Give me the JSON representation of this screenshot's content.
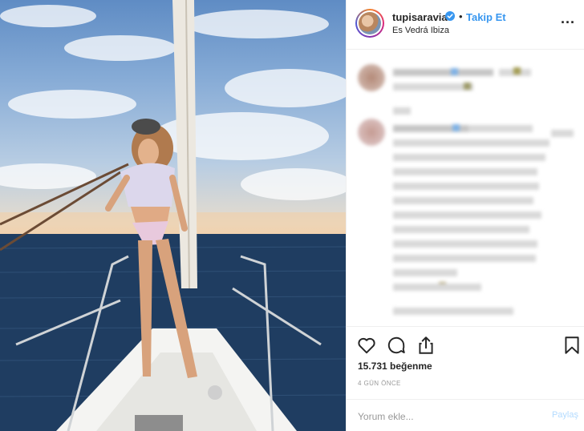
{
  "header": {
    "username": "tupisaravia",
    "dot": "•",
    "follow_label": "Takip Et",
    "location": "Es Vedrá Ibiza",
    "more_label": "..."
  },
  "actions": {
    "likes": "15.731 beğenme",
    "time_ago": "4 GÜN ÖNCE"
  },
  "comment_box": {
    "placeholder": "Yorum ekle...",
    "submit_label": "Paylaş"
  },
  "colors": {
    "accent": "#3897f0",
    "verified": "#3897f0",
    "submit_disabled": "#b3dbff"
  },
  "icons": [
    "verified-badge-icon",
    "more-options-icon",
    "heart-icon",
    "comment-icon",
    "share-icon",
    "bookmark-icon"
  ]
}
